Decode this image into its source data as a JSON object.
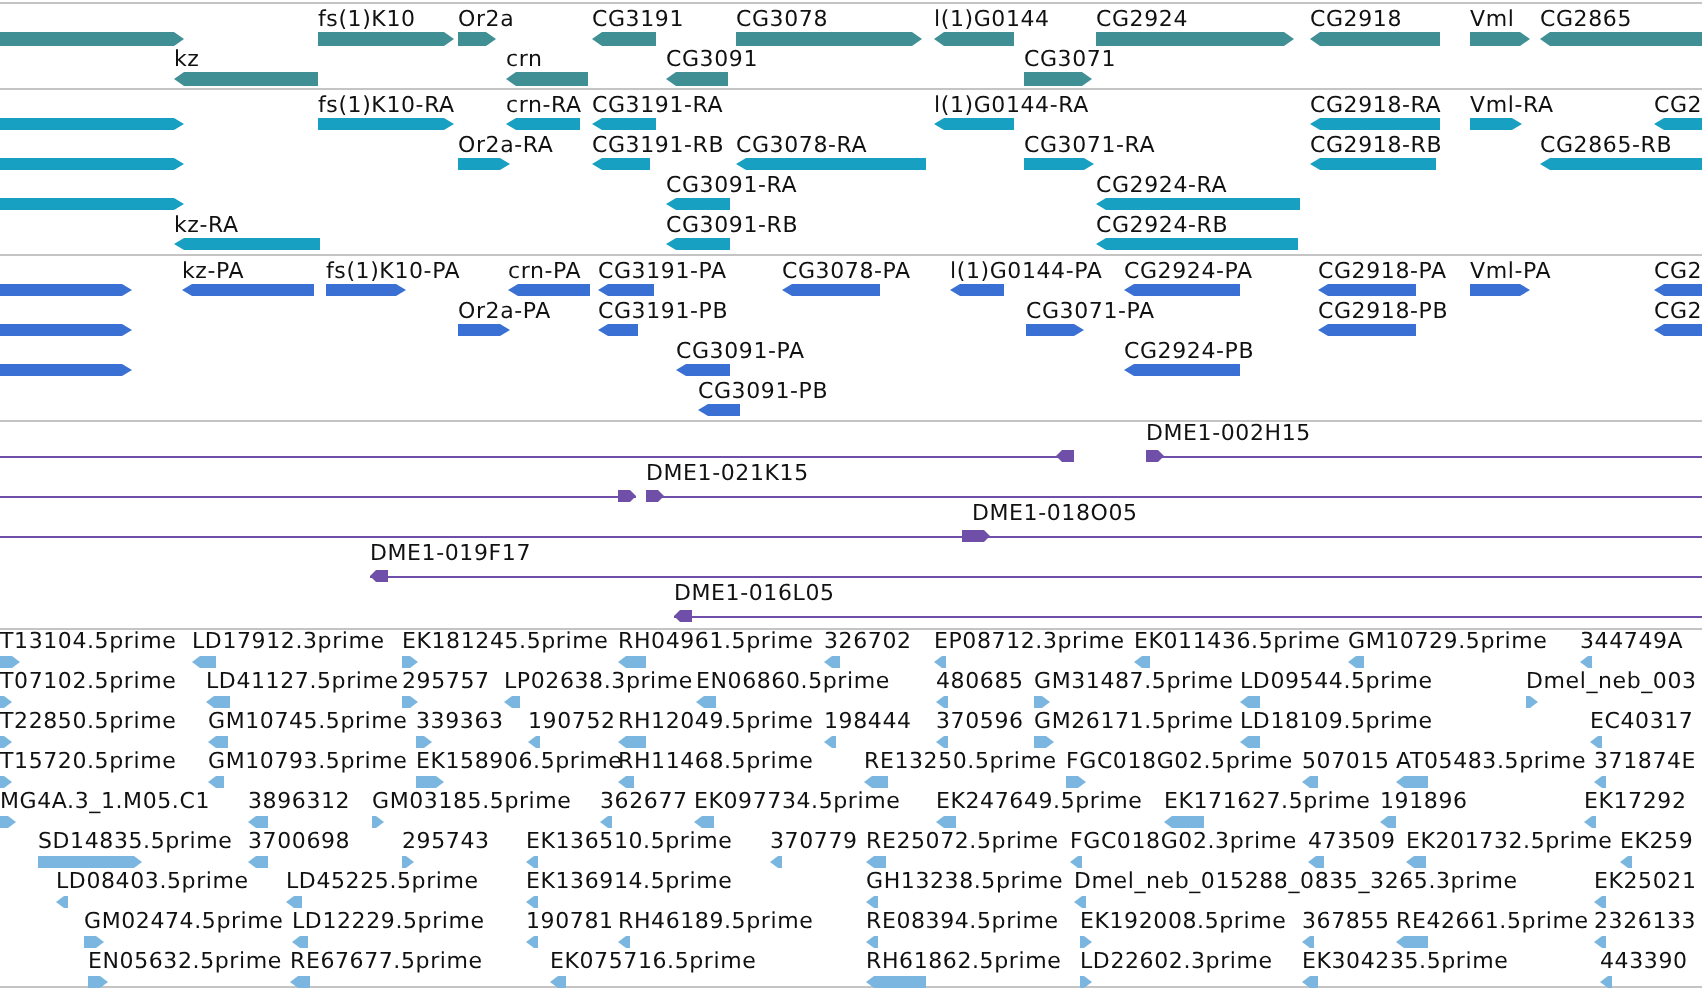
{
  "tracks": [
    {
      "kind": "gene",
      "lanes": [
        {
          "features": [
            {
              "reverse": false
            },
            {
              "label": "fs(1)K10",
              "reverse": false
            },
            {
              "label": "Or2a",
              "reverse": false
            },
            {
              "label": "CG3191",
              "reverse": true
            },
            {
              "label": "CG3078",
              "reverse": false
            },
            {
              "label": "l(1)G0144",
              "reverse": true
            },
            {
              "label": "CG2924",
              "reverse": false
            },
            {
              "label": "CG2918",
              "reverse": true
            },
            {
              "label": "Vml",
              "reverse": false
            },
            {
              "label": "CG2865",
              "reverse": true
            }
          ]
        },
        {
          "features": [
            {
              "label": "kz",
              "reverse": true
            },
            {
              "label": "crn",
              "reverse": true
            },
            {
              "label": "CG3091",
              "reverse": true
            },
            {
              "label": "CG3071",
              "reverse": false
            }
          ]
        }
      ]
    },
    {
      "kind": "transcript",
      "lanes": [
        {
          "features": [
            {
              "reverse": false
            },
            {
              "label": "fs(1)K10-RA",
              "reverse": false
            },
            {
              "label": "crn-RA",
              "reverse": true
            },
            {
              "label": "CG3191-RA",
              "reverse": true
            },
            {
              "label": "l(1)G0144-RA",
              "reverse": true
            },
            {
              "label": "CG2918-RA",
              "reverse": true
            },
            {
              "label": "Vml-RA",
              "reverse": false
            },
            {
              "label": "CG2",
              "reverse": true
            }
          ]
        },
        {
          "features": [
            {
              "reverse": false
            },
            {
              "label": "Or2a-RA",
              "reverse": false
            },
            {
              "label": "CG3191-RB",
              "reverse": true
            },
            {
              "label": "CG3078-RA",
              "reverse": true
            },
            {
              "label": "CG3071-RA",
              "reverse": false
            },
            {
              "label": "CG2918-RB",
              "reverse": true
            },
            {
              "label": "CG2865-RB",
              "reverse": true
            }
          ]
        },
        {
          "features": [
            {
              "reverse": false
            },
            {
              "label": "CG3091-RA",
              "reverse": true
            },
            {
              "label": "CG2924-RA",
              "reverse": true
            }
          ]
        },
        {
          "features": [
            {
              "label": "kz-RA",
              "reverse": true
            },
            {
              "label": "CG3091-RB",
              "reverse": true
            },
            {
              "label": "CG2924-RB",
              "reverse": true
            }
          ]
        }
      ]
    },
    {
      "kind": "protein",
      "lanes": [
        {
          "features": [
            {
              "reverse": false
            },
            {
              "label": "kz-PA",
              "reverse": true
            },
            {
              "label": "fs(1)K10-PA",
              "reverse": false
            },
            {
              "label": "crn-PA",
              "reverse": true
            },
            {
              "label": "CG3191-PA",
              "reverse": true
            },
            {
              "label": "CG3078-PA",
              "reverse": true
            },
            {
              "label": "l(1)G0144-PA",
              "reverse": true
            },
            {
              "label": "CG2924-PA",
              "reverse": true
            },
            {
              "label": "CG2918-PA",
              "reverse": true
            },
            {
              "label": "Vml-PA",
              "reverse": false
            },
            {
              "label": "CG2",
              "reverse": true
            }
          ]
        },
        {
          "features": [
            {
              "reverse": false
            },
            {
              "label": "Or2a-PA",
              "reverse": false
            },
            {
              "label": "CG3191-PB",
              "reverse": true
            },
            {
              "label": "CG3071-PA",
              "reverse": false
            },
            {
              "label": "CG2918-PB",
              "reverse": true
            },
            {
              "label": "CG2",
              "reverse": true
            }
          ]
        },
        {
          "features": [
            {
              "reverse": false
            },
            {
              "label": "CG3091-PA",
              "reverse": true
            },
            {
              "label": "CG2924-PB",
              "reverse": true
            }
          ]
        },
        {
          "features": [
            {
              "label": "CG3091-PB",
              "reverse": true
            }
          ]
        }
      ]
    },
    {
      "kind": "clone",
      "lanes": [
        {
          "features": [
            {
              "reverse": true
            },
            {
              "label": "DME1-002H15",
              "reverse": false
            }
          ]
        },
        {
          "features": [
            {
              "reverse": false
            },
            {
              "label": "DME1-021K15",
              "reverse": false
            }
          ]
        },
        {
          "features": [
            {
              "reverse": false
            },
            {
              "label": "DME1-018O05",
              "reverse": false
            }
          ]
        },
        {
          "features": [
            {
              "label": "DME1-019F17",
              "reverse": true
            }
          ]
        },
        {
          "features": [
            {
              "label": "DME1-016L05",
              "reverse": true
            }
          ]
        }
      ]
    },
    {
      "kind": "est",
      "lanes": [
        {
          "features": [
            {
              "label": "T13104.5prime",
              "reverse": false
            },
            {
              "label": "LD17912.3prime",
              "reverse": true
            },
            {
              "label": "EK181245.5prime",
              "reverse": false
            },
            {
              "label": "RH04961.5prime",
              "reverse": true
            },
            {
              "label": "326702",
              "reverse": true
            },
            {
              "label": "EP08712.3prime",
              "reverse": true
            },
            {
              "label": "EK011436.5prime",
              "reverse": true
            },
            {
              "label": "GM10729.5prime",
              "reverse": true
            },
            {
              "label": "344749A",
              "reverse": true
            }
          ]
        },
        {
          "features": [
            {
              "label": "T07102.5prime",
              "reverse": false
            },
            {
              "label": "LD41127.5prime",
              "reverse": true
            },
            {
              "label": "295757",
              "reverse": false
            },
            {
              "label": "LP02638.3prime",
              "reverse": true
            },
            {
              "label": "EN06860.5prime",
              "reverse": true
            },
            {
              "label": "480685",
              "reverse": true
            },
            {
              "label": "GM31487.5prime",
              "reverse": false
            },
            {
              "label": "LD09544.5prime",
              "reverse": true
            },
            {
              "label": "Dmel_neb_003",
              "reverse": false
            }
          ]
        },
        {
          "features": [
            {
              "label": "T22850.5prime",
              "reverse": false
            },
            {
              "label": "GM10745.5prime",
              "reverse": true
            },
            {
              "label": "339363",
              "reverse": false
            },
            {
              "label": "190752",
              "reverse": true
            },
            {
              "label": "RH12049.5prime",
              "reverse": true
            },
            {
              "label": "198444",
              "reverse": true
            },
            {
              "label": "370596",
              "reverse": true
            },
            {
              "label": "GM26171.5prime",
              "reverse": false
            },
            {
              "label": "LD18109.5prime",
              "reverse": true
            },
            {
              "label": "EC40317",
              "reverse": true
            }
          ]
        },
        {
          "features": [
            {
              "label": "T15720.5prime",
              "reverse": false
            },
            {
              "label": "GM10793.5prime",
              "reverse": true
            },
            {
              "label": "EK158906.5prime",
              "reverse": false
            },
            {
              "label": "RH11468.5prime",
              "reverse": true
            },
            {
              "label": "RE13250.5prime",
              "reverse": true
            },
            {
              "label": "FGC018G02.5prime",
              "reverse": false
            },
            {
              "label": "507015",
              "reverse": true
            },
            {
              "label": "AT05483.5prime",
              "reverse": true
            },
            {
              "label": "371874E",
              "reverse": true
            }
          ]
        },
        {
          "features": [
            {
              "label": "MG4A.3_1.M05.C1",
              "reverse": false
            },
            {
              "label": "3896312",
              "reverse": true
            },
            {
              "label": "GM03185.5prime",
              "reverse": false
            },
            {
              "label": "362677",
              "reverse": true
            },
            {
              "label": "EK097734.5prime",
              "reverse": true
            },
            {
              "label": "EK247649.5prime",
              "reverse": true
            },
            {
              "label": "EK171627.5prime",
              "reverse": true
            },
            {
              "label": "191896",
              "reverse": true
            },
            {
              "label": "EK17292",
              "reverse": true
            }
          ]
        },
        {
          "features": [
            {
              "label": "SD14835.5prime",
              "reverse": false
            },
            {
              "label": "3700698",
              "reverse": true
            },
            {
              "label": "295743",
              "reverse": false
            },
            {
              "label": "EK136510.5prime",
              "reverse": true
            },
            {
              "label": "370779",
              "reverse": true
            },
            {
              "label": "RE25072.5prime",
              "reverse": true
            },
            {
              "label": "FGC018G02.3prime",
              "reverse": true
            },
            {
              "label": "473509",
              "reverse": true
            },
            {
              "label": "EK201732.5prime",
              "reverse": true
            },
            {
              "label": "EK259",
              "reverse": true
            }
          ]
        },
        {
          "features": [
            {
              "label": "LD08403.5prime",
              "reverse": true
            },
            {
              "label": "LD45225.5prime",
              "reverse": true
            },
            {
              "label": "EK136914.5prime",
              "reverse": true
            },
            {
              "label": "GH13238.5prime",
              "reverse": true
            },
            {
              "label": "Dmel_neb_015288_0835_3265.3prime",
              "reverse": true
            },
            {
              "label": "EK25021",
              "reverse": true
            }
          ]
        },
        {
          "features": [
            {
              "label": "GM02474.5prime",
              "reverse": false
            },
            {
              "label": "LD12229.5prime",
              "reverse": true
            },
            {
              "label": "190781",
              "reverse": true
            },
            {
              "label": "RH46189.5prime",
              "reverse": true
            },
            {
              "label": "RE08394.5prime",
              "reverse": true
            },
            {
              "label": "EK192008.5prime",
              "reverse": false
            },
            {
              "label": "367855",
              "reverse": true
            },
            {
              "label": "RE42661.5prime",
              "reverse": true
            },
            {
              "label": "2326133",
              "reverse": true
            }
          ]
        },
        {
          "features": [
            {
              "label": "EN05632.5prime",
              "reverse": false
            },
            {
              "label": "RE67677.5prime",
              "reverse": true
            },
            {
              "label": "EK075716.5prime",
              "reverse": true
            },
            {
              "label": "RH61862.5prime",
              "reverse": true
            },
            {
              "label": "LD22602.3prime",
              "reverse": false
            },
            {
              "label": "EK304235.5prime",
              "reverse": true
            },
            {
              "label": "443390",
              "reverse": true
            }
          ]
        }
      ]
    }
  ]
}
